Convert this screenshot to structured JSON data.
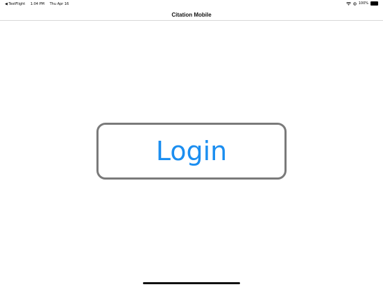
{
  "status_bar": {
    "back_app": "◀ TestFlight",
    "time": "1:04 PM",
    "date": "Thu Apr 16",
    "battery_percent": "100%",
    "wifi_icon": "wifi-icon",
    "battery_level": 1.0
  },
  "nav": {
    "title": "Citation Mobile"
  },
  "main": {
    "login_label": "Login"
  },
  "colors": {
    "accent": "#1b8ef0",
    "button_border": "#7a7a7a"
  }
}
